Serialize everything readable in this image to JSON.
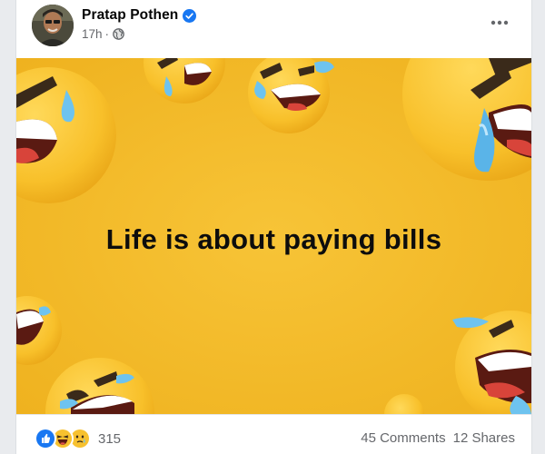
{
  "post": {
    "author": "Pratap Pothen",
    "time": "17h",
    "separator": "·",
    "visibility_icon": "globe-icon",
    "verified_icon": "verified-badge-icon",
    "more_icon": "more-options-icon"
  },
  "image": {
    "caption": "Life is about paying bills",
    "background_color": "#f6bf2e"
  },
  "footer": {
    "reaction_icons": [
      "like-icon",
      "haha-icon",
      "care-icon"
    ],
    "reaction_count": "315",
    "comments": "45 Comments",
    "shares": "12 Shares"
  },
  "colors": {
    "facebook_blue": "#1877f2",
    "secondary_text": "#65676b",
    "primary_text": "#050505"
  }
}
